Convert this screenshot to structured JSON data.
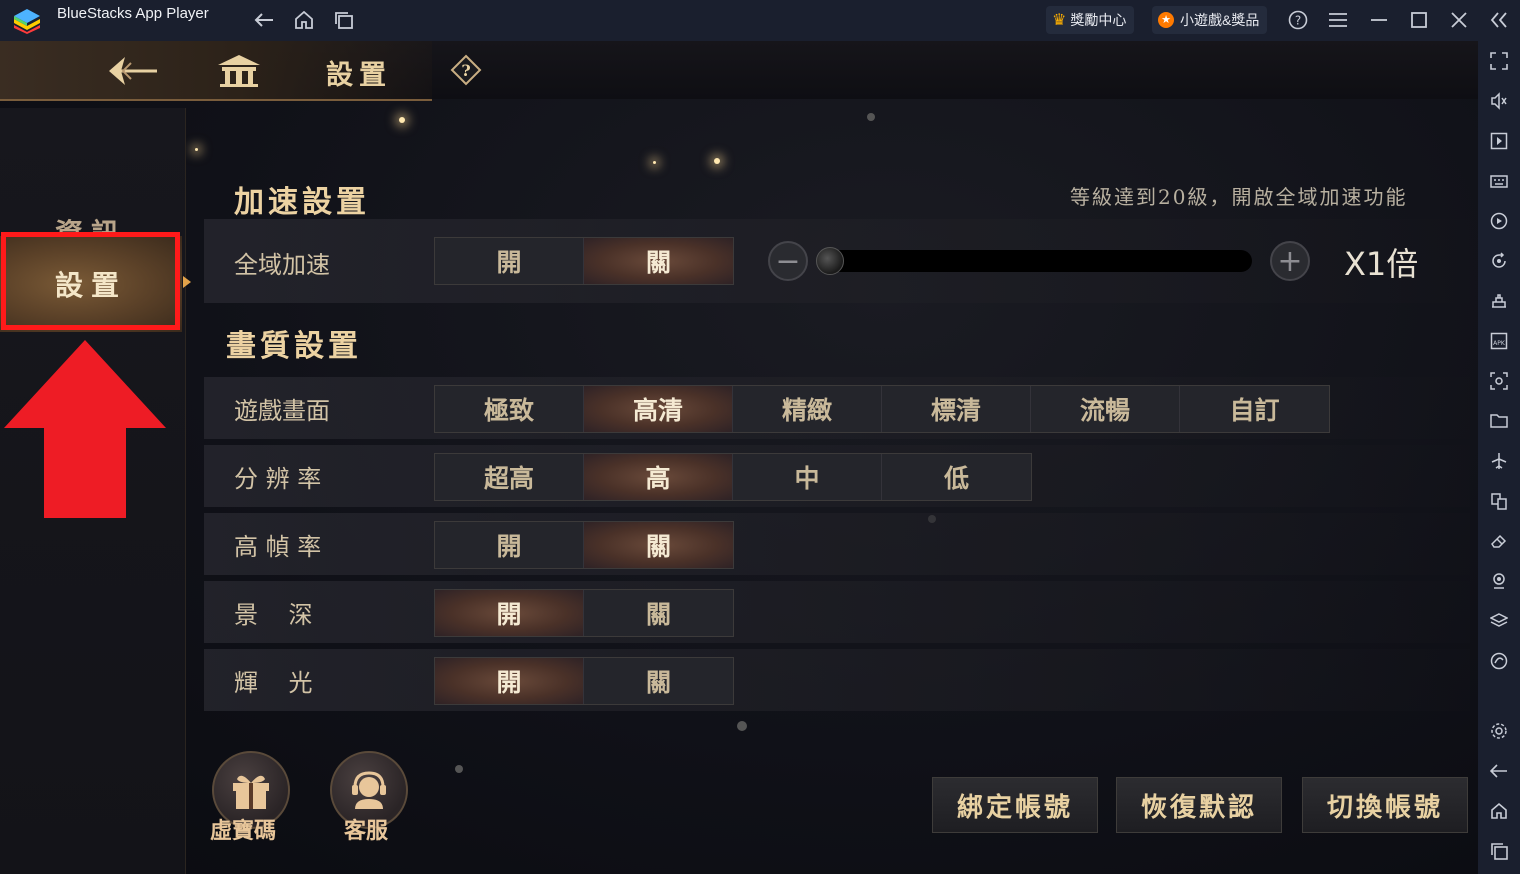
{
  "window": {
    "title": "BlueStacks App Player",
    "rewards_label": "獎勵中心",
    "games_label": "小遊戲&獎品"
  },
  "colors": {
    "accent_gold": "#e8d1a2",
    "highlight_red": "#ff1a1a",
    "titlebar_bg": "#1a1f2e"
  },
  "header": {
    "title": "設置"
  },
  "nav": {
    "items": [
      {
        "label": "資訊",
        "active": false
      },
      {
        "label": "設置",
        "active": true
      }
    ]
  },
  "speed": {
    "section_title": "加速設置",
    "note": "等級達到20級，開啟全域加速功能",
    "row_label": "全域加速",
    "options": [
      "開",
      "關"
    ],
    "selected": "關",
    "multiplier": "X1倍",
    "slider_level": 0
  },
  "quality": {
    "section_title": "畫質設置",
    "rows": [
      {
        "label": "遊戲畫面",
        "options": [
          "極致",
          "高清",
          "精緻",
          "標清",
          "流暢",
          "自訂"
        ],
        "selected": "高清"
      },
      {
        "label": "分 辨 率",
        "options": [
          "超高",
          "高",
          "中",
          "低"
        ],
        "selected": "高"
      },
      {
        "label": "高 幀 率",
        "options": [
          "開",
          "關"
        ],
        "selected": "關"
      },
      {
        "label": "景    深",
        "options": [
          "開",
          "關"
        ],
        "selected": "開"
      },
      {
        "label": "輝    光",
        "options": [
          "開",
          "關"
        ],
        "selected": "開"
      }
    ]
  },
  "bottom": {
    "gift_label": "虛寶碼",
    "service_label": "客服",
    "bind_label": "綁定帳號",
    "restore_label": "恢復默認",
    "switch_label": "切換帳號"
  },
  "icons": {
    "right_sidebar": [
      "fullscreen-icon",
      "volume-icon",
      "media-icon",
      "keyboard-icon",
      "record-icon",
      "rotate-icon",
      "controls-icon",
      "apk-icon",
      "screenshot-icon",
      "folder-icon",
      "airplane-icon",
      "multi-instance-icon",
      "erase-icon",
      "location-icon",
      "layers-icon",
      "eco-icon",
      "settings-icon",
      "back-icon",
      "home-icon",
      "recent-apps-icon"
    ]
  }
}
